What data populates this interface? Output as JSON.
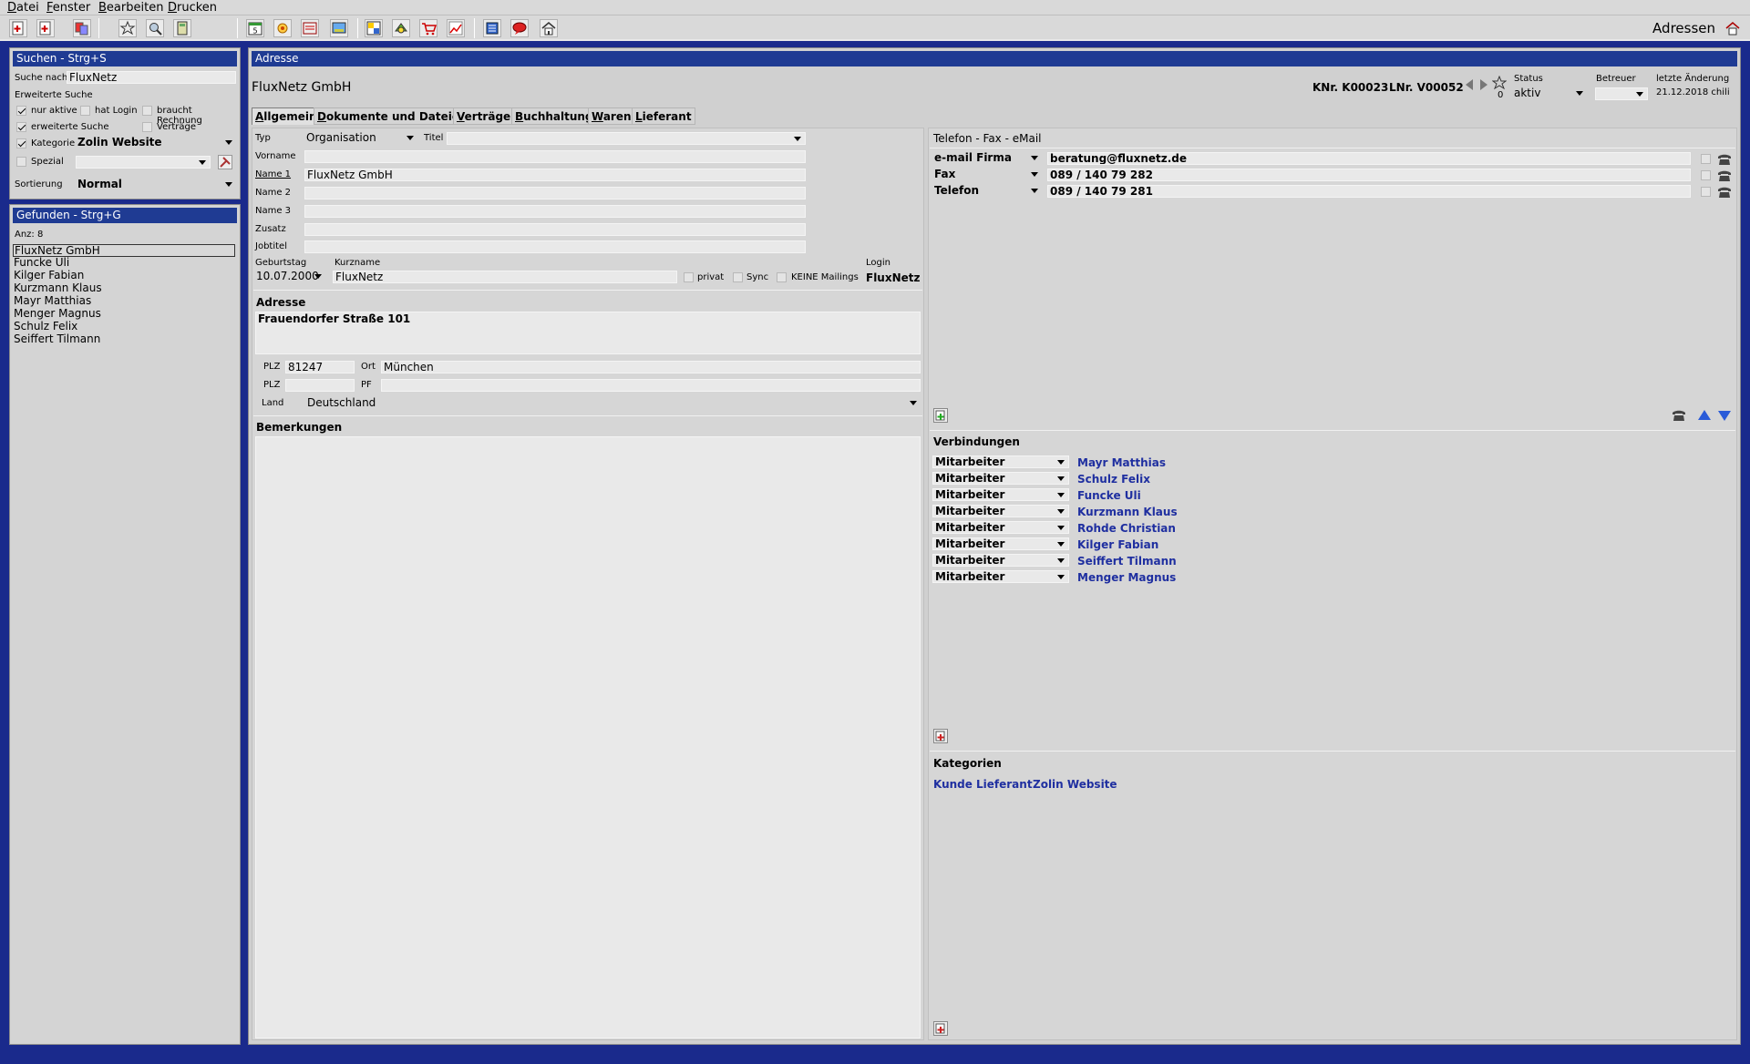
{
  "menu": [
    "Datei",
    "Fenster",
    "Bearbeiten",
    "Drucken"
  ],
  "toolbar": {
    "icons": [
      "new-doc-icon",
      "new-doc-red-icon",
      "swap-icon",
      "star-icon",
      "magnifier-icon",
      "calculator-icon",
      "calendar-icon",
      "flower-icon",
      "inbox-icon",
      "screen-icon",
      "window-icon",
      "gear-icon",
      "cart-icon",
      "chart-icon",
      "book-icon",
      "chat-icon",
      "home-icon"
    ],
    "calendar_day": "5",
    "app_title": "Adressen"
  },
  "search": {
    "header": "Suchen - Strg+S",
    "search_label": "Suche nach",
    "search_value": "FluxNetz",
    "advanced_label": "Erweiterte Suche",
    "nur_aktive": "nur aktive",
    "hat_login": "hat Login",
    "braucht_rechnung": "braucht Rechnung",
    "erweiterte_suche": "erweiterte Suche",
    "vertraege": "Verträge",
    "kategorie_label": "Kategorie",
    "kategorie_value": "Zolin Website",
    "spezial_label": "Spezial",
    "sort_label": "Sortierung",
    "sort_value": "Normal"
  },
  "found": {
    "header": "Gefunden - Strg+G",
    "count": "Anz: 8",
    "items": [
      "FluxNetz GmbH",
      "Funcke Uli",
      "Kilger Fabian",
      "Kurzmann Klaus",
      "Mayr Matthias",
      "Menger Magnus",
      "Schulz Felix",
      "Seiffert Tilmann"
    ]
  },
  "address": {
    "header": "Adresse",
    "company": "FluxNetz GmbH",
    "knr": "KNr. K00023",
    "lnr": "LNr. V00052",
    "nav_count": "0",
    "status_label": "Status",
    "status_value": "aktiv",
    "betreuer_label": "Betreuer",
    "betreuer_value": "",
    "last_change_label": "letzte Änderung",
    "last_change_value": "21.12.2018 chili",
    "tabs": [
      "Allgemein",
      "Dokumente und Dateien",
      "Verträge",
      "Buchhaltung",
      "Waren",
      "Lieferant"
    ],
    "typ_label": "Typ",
    "typ_value": "Organisation",
    "titel_label": "Titel",
    "titel_value": "",
    "vorname_label": "Vorname",
    "vorname_value": "",
    "name1_label": "Name 1",
    "name1_value": "FluxNetz GmbH",
    "name2_label": "Name 2",
    "name3_label": "Name 3",
    "zusatz_label": "Zusatz",
    "jobtitel_label": "Jobtitel",
    "geburtstag_label": "Geburtstag",
    "geburtstag_value": "10.07.2000",
    "kurzname_label": "Kurzname",
    "kurzname_value": "FluxNetz",
    "privat": "privat",
    "sync": "Sync",
    "keine_mailings": "KEINE Mailings",
    "login_label": "Login",
    "login_value": "FluxNetz",
    "adresse_title": "Adresse",
    "street": "Frauendorfer Straße 101",
    "plz_label": "PLZ",
    "plz_value": "81247",
    "ort_label": "Ort",
    "ort_value": "München",
    "plz2_label": "PLZ",
    "pf_label": "PF",
    "land_label": "Land",
    "land_value": "Deutschland",
    "bemerkungen_title": "Bemerkungen"
  },
  "contact": {
    "title": "Telefon - Fax - eMail",
    "rows": [
      {
        "type": "e-mail Firma",
        "value": "beratung@fluxnetz.de"
      },
      {
        "type": "Fax",
        "value": "089 / 140 79 282"
      },
      {
        "type": "Telefon",
        "value": "089 / 140 79 281"
      }
    ]
  },
  "connections": {
    "title": "Verbindungen",
    "rows": [
      {
        "role": "Mitarbeiter",
        "name": "Mayr Matthias"
      },
      {
        "role": "Mitarbeiter",
        "name": "Schulz Felix"
      },
      {
        "role": "Mitarbeiter",
        "name": "Funcke Uli"
      },
      {
        "role": "Mitarbeiter",
        "name": "Kurzmann Klaus"
      },
      {
        "role": "Mitarbeiter",
        "name": "Rohde Christian"
      },
      {
        "role": "Mitarbeiter",
        "name": "Kilger Fabian"
      },
      {
        "role": "Mitarbeiter",
        "name": "Seiffert Tilmann"
      },
      {
        "role": "Mitarbeiter",
        "name": "Menger Magnus"
      }
    ]
  },
  "categories": {
    "title": "Kategorien",
    "items": [
      "Kunde",
      "Lieferant",
      "Zolin Website"
    ]
  }
}
